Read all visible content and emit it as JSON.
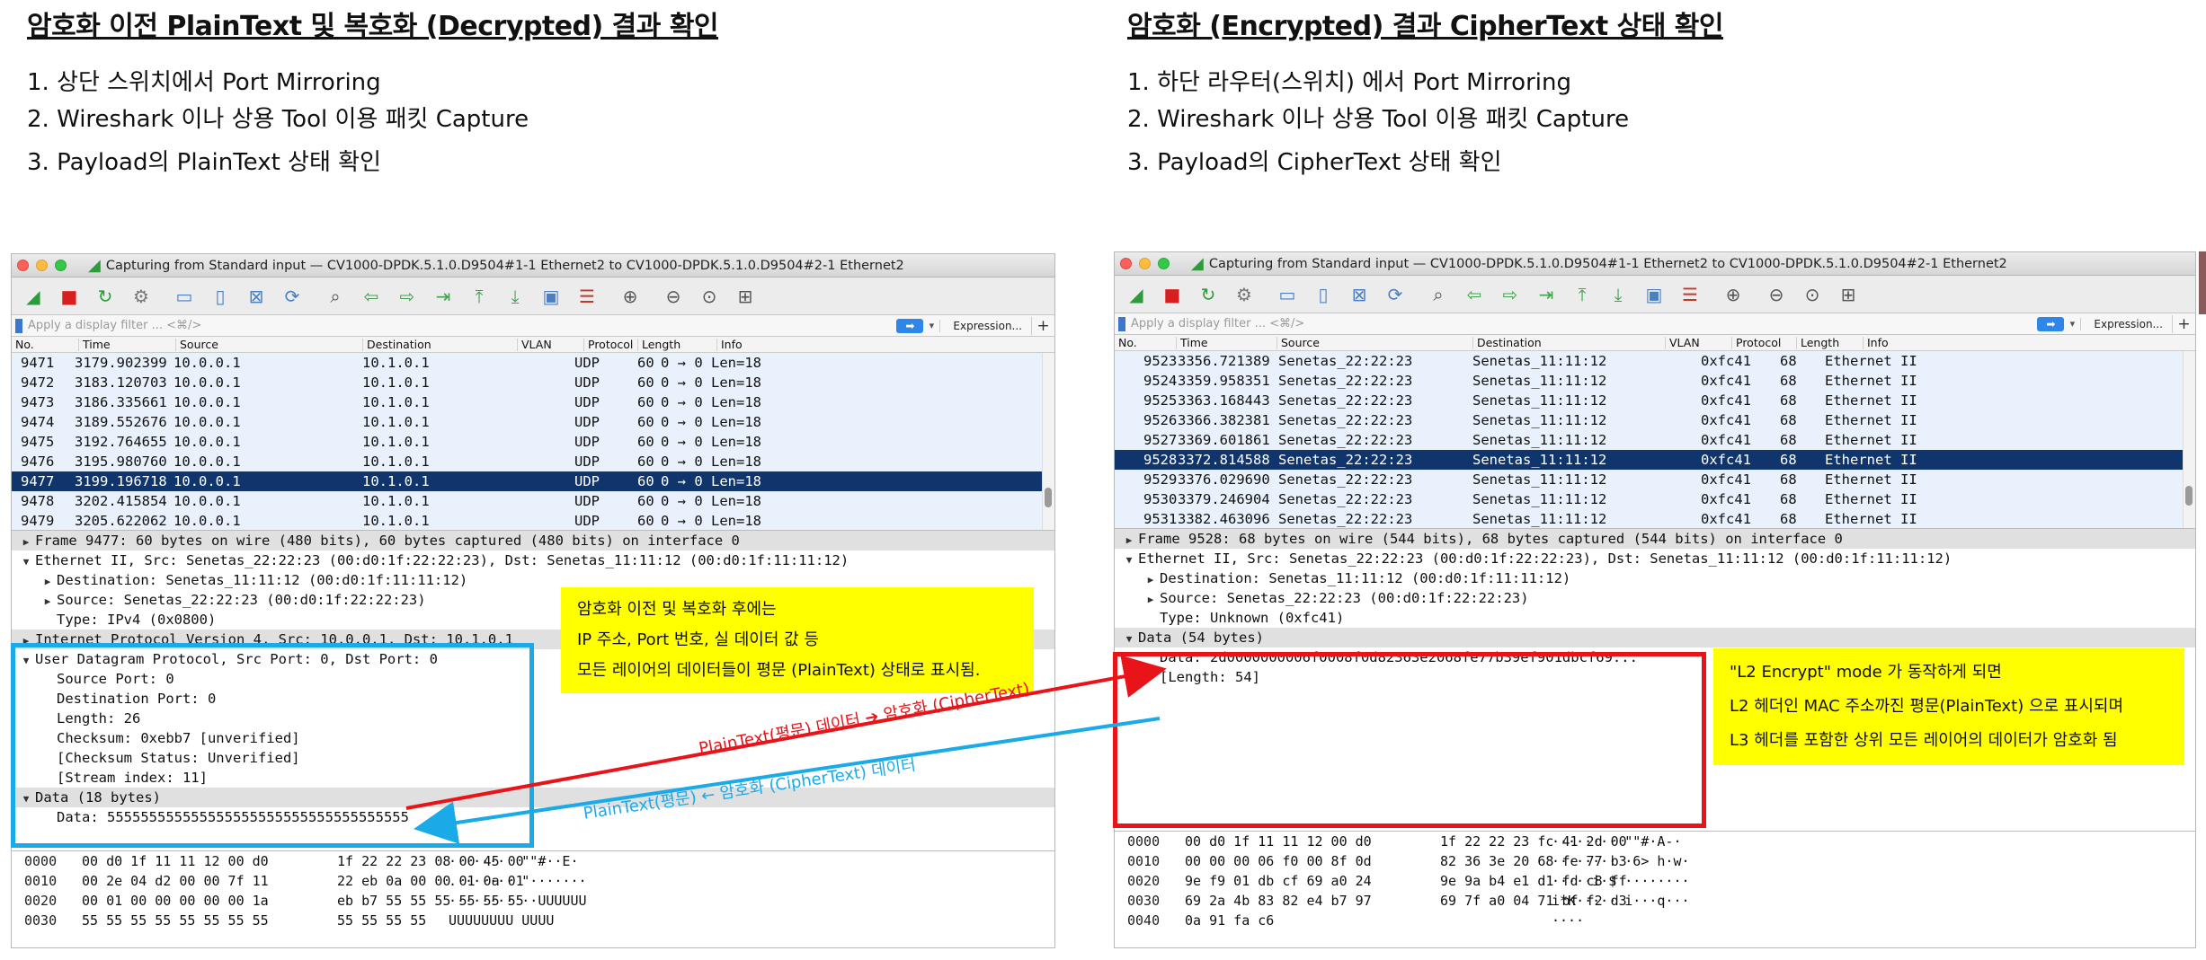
{
  "left": {
    "heading": "암호화 이전 PlainText 및 복호화 (Decrypted) 결과 확인",
    "steps": [
      "1. 상단 스위치에서 Port Mirroring",
      "2. Wireshark 이나 상용 Tool 이용 패킷 Capture",
      "3. Payload의 PlainText 상태 확인"
    ],
    "window_title": "Capturing from Standard input — CV1000-DPDK.5.1.0.D9504#1-1 Ethernet2 to CV1000-DPDK.5.1.0.D9504#2-1 Ethernet2",
    "filter_placeholder": "Apply a display filter ... <⌘/>",
    "expression_label": "Expression...",
    "columns": [
      "No.",
      "Time",
      "Source",
      "Destination",
      "VLAN",
      "Protocol",
      "Length",
      "Info"
    ],
    "packets": [
      {
        "no": "9471",
        "time": "3179.902399",
        "src": "10.0.0.1",
        "dst": "10.1.0.1",
        "vlan": "",
        "proto": "UDP",
        "len": "60",
        "info": "0 → 0 Len=18"
      },
      {
        "no": "9472",
        "time": "3183.120703",
        "src": "10.0.0.1",
        "dst": "10.1.0.1",
        "vlan": "",
        "proto": "UDP",
        "len": "60",
        "info": "0 → 0 Len=18"
      },
      {
        "no": "9473",
        "time": "3186.335661",
        "src": "10.0.0.1",
        "dst": "10.1.0.1",
        "vlan": "",
        "proto": "UDP",
        "len": "60",
        "info": "0 → 0 Len=18"
      },
      {
        "no": "9474",
        "time": "3189.552676",
        "src": "10.0.0.1",
        "dst": "10.1.0.1",
        "vlan": "",
        "proto": "UDP",
        "len": "60",
        "info": "0 → 0 Len=18"
      },
      {
        "no": "9475",
        "time": "3192.764655",
        "src": "10.0.0.1",
        "dst": "10.1.0.1",
        "vlan": "",
        "proto": "UDP",
        "len": "60",
        "info": "0 → 0 Len=18"
      },
      {
        "no": "9476",
        "time": "3195.980760",
        "src": "10.0.0.1",
        "dst": "10.1.0.1",
        "vlan": "",
        "proto": "UDP",
        "len": "60",
        "info": "0 → 0 Len=18"
      },
      {
        "no": "9477",
        "time": "3199.196718",
        "src": "10.0.0.1",
        "dst": "10.1.0.1",
        "vlan": "",
        "proto": "UDP",
        "len": "60",
        "info": "0 → 0 Len=18",
        "selected": true
      },
      {
        "no": "9478",
        "time": "3202.415854",
        "src": "10.0.0.1",
        "dst": "10.1.0.1",
        "vlan": "",
        "proto": "UDP",
        "len": "60",
        "info": "0 → 0 Len=18"
      },
      {
        "no": "9479",
        "time": "3205.622062",
        "src": "10.0.0.1",
        "dst": "10.1.0.1",
        "vlan": "",
        "proto": "UDP",
        "len": "60",
        "info": "0 → 0 Len=18"
      }
    ],
    "details": [
      {
        "indent": 0,
        "toggle": "▶",
        "text": "Frame 9477: 60 bytes on wire (480 bits), 60 bytes captured (480 bits) on interface 0",
        "hl": true
      },
      {
        "indent": 0,
        "toggle": "▼",
        "text": "Ethernet II, Src: Senetas_22:22:23 (00:d0:1f:22:22:23), Dst: Senetas_11:11:12 (00:d0:1f:11:11:12)",
        "hl": false
      },
      {
        "indent": 1,
        "toggle": "▶",
        "text": "Destination: Senetas_11:11:12 (00:d0:1f:11:11:12)",
        "hl": false
      },
      {
        "indent": 1,
        "toggle": "▶",
        "text": "Source: Senetas_22:22:23 (00:d0:1f:22:22:23)",
        "hl": false
      },
      {
        "indent": 1,
        "toggle": "",
        "text": "Type: IPv4 (0x0800)",
        "hl": false
      },
      {
        "indent": 0,
        "toggle": "▶",
        "text": "Internet Protocol Version 4, Src: 10.0.0.1, Dst: 10.1.0.1",
        "hl": true
      },
      {
        "indent": 0,
        "toggle": "▼",
        "text": "User Datagram Protocol, Src Port: 0, Dst Port: 0",
        "hl": false
      },
      {
        "indent": 1,
        "toggle": "",
        "text": "Source Port: 0",
        "hl": false
      },
      {
        "indent": 1,
        "toggle": "",
        "text": "Destination Port: 0",
        "hl": false
      },
      {
        "indent": 1,
        "toggle": "",
        "text": "Length: 26",
        "hl": false
      },
      {
        "indent": 1,
        "toggle": "",
        "text": "Checksum: 0xebb7 [unverified]",
        "hl": false
      },
      {
        "indent": 1,
        "toggle": "",
        "text": "[Checksum Status: Unverified]",
        "hl": false
      },
      {
        "indent": 1,
        "toggle": "",
        "text": "[Stream index: 11]",
        "hl": false
      },
      {
        "indent": 0,
        "toggle": "▼",
        "text": "Data (18 bytes)",
        "hl": true
      },
      {
        "indent": 1,
        "toggle": "",
        "text": "Data: 555555555555555555555555555555555555",
        "hl": false
      }
    ],
    "hex": [
      {
        "off": "0000",
        "a": "00 d0 1f 11 11 12 00 d0",
        "b": "1f 22 22 23 08 00 45 00",
        "ascii": "·······  \"\"#··E·"
      },
      {
        "off": "0010",
        "a": "00 2e 04 d2 00 00 7f 11",
        "b": "22 eb 0a 00 00 01 0a 01",
        "ascii": ".······· \"·······"
      },
      {
        "off": "0020",
        "a": "00 01 00 00 00 00 00 1a",
        "b": "eb b7 55 55 55 55 55 55",
        "ascii": "········ ··UUUUUU"
      },
      {
        "off": "0030",
        "a": "55 55 55 55 55 55 55 55",
        "b": "55 55 55 55",
        "ascii": "UUUUUUUU UUUU"
      }
    ],
    "callout": [
      "암호화 이전 및 복호화 후에는",
      "IP 주소, Port 번호, 실 데이터 값 등",
      "모든 레이어의 데이터들이 평문 (PlainText) 상태로 표시됨."
    ]
  },
  "right": {
    "heading": "암호화 (Encrypted) 결과 CipherText 상태 확인",
    "steps": [
      "1. 하단 라우터(스위치) 에서 Port Mirroring",
      "2. Wireshark 이나 상용 Tool 이용 패킷 Capture",
      "3. Payload의 CipherText 상태 확인"
    ],
    "window_title": "Capturing from Standard input — CV1000-DPDK.5.1.0.D9504#1-1 Ethernet2 to CV1000-DPDK.5.1.0.D9504#2-1 Ethernet2",
    "filter_placeholder": "Apply a display filter ... <⌘/>",
    "expression_label": "Expression...",
    "columns": [
      "No.",
      "Time",
      "Source",
      "Destination",
      "VLAN",
      "Protocol",
      "Length",
      "Info"
    ],
    "packets": [
      {
        "no": "9523",
        "time": "3356.721389",
        "src": "Senetas_22:22:23",
        "dst": "Senetas_11:11:12",
        "vlan": "",
        "proto": "0xfc41",
        "len": "68",
        "info": "Ethernet II"
      },
      {
        "no": "9524",
        "time": "3359.958351",
        "src": "Senetas_22:22:23",
        "dst": "Senetas_11:11:12",
        "vlan": "",
        "proto": "0xfc41",
        "len": "68",
        "info": "Ethernet II"
      },
      {
        "no": "9525",
        "time": "3363.168443",
        "src": "Senetas_22:22:23",
        "dst": "Senetas_11:11:12",
        "vlan": "",
        "proto": "0xfc41",
        "len": "68",
        "info": "Ethernet II"
      },
      {
        "no": "9526",
        "time": "3366.382381",
        "src": "Senetas_22:22:23",
        "dst": "Senetas_11:11:12",
        "vlan": "",
        "proto": "0xfc41",
        "len": "68",
        "info": "Ethernet II"
      },
      {
        "no": "9527",
        "time": "3369.601861",
        "src": "Senetas_22:22:23",
        "dst": "Senetas_11:11:12",
        "vlan": "",
        "proto": "0xfc41",
        "len": "68",
        "info": "Ethernet II"
      },
      {
        "no": "9528",
        "time": "3372.814588",
        "src": "Senetas_22:22:23",
        "dst": "Senetas_11:11:12",
        "vlan": "",
        "proto": "0xfc41",
        "len": "68",
        "info": "Ethernet II",
        "selected": true
      },
      {
        "no": "9529",
        "time": "3376.029690",
        "src": "Senetas_22:22:23",
        "dst": "Senetas_11:11:12",
        "vlan": "",
        "proto": "0xfc41",
        "len": "68",
        "info": "Ethernet II"
      },
      {
        "no": "9530",
        "time": "3379.246904",
        "src": "Senetas_22:22:23",
        "dst": "Senetas_11:11:12",
        "vlan": "",
        "proto": "0xfc41",
        "len": "68",
        "info": "Ethernet II"
      },
      {
        "no": "9531",
        "time": "3382.463096",
        "src": "Senetas_22:22:23",
        "dst": "Senetas_11:11:12",
        "vlan": "",
        "proto": "0xfc41",
        "len": "68",
        "info": "Ethernet II"
      }
    ],
    "details": [
      {
        "indent": 0,
        "toggle": "▶",
        "text": "Frame 9528: 68 bytes on wire (544 bits), 68 bytes captured (544 bits) on interface 0",
        "hl": true
      },
      {
        "indent": 0,
        "toggle": "▼",
        "text": "Ethernet II, Src: Senetas_22:22:23 (00:d0:1f:22:22:23), Dst: Senetas_11:11:12 (00:d0:1f:11:11:12)",
        "hl": false
      },
      {
        "indent": 1,
        "toggle": "▶",
        "text": "Destination: Senetas_11:11:12 (00:d0:1f:11:11:12)",
        "hl": false
      },
      {
        "indent": 1,
        "toggle": "▶",
        "text": "Source: Senetas_22:22:23 (00:d0:1f:22:22:23)",
        "hl": false
      },
      {
        "indent": 1,
        "toggle": "",
        "text": "Type: Unknown (0xfc41)",
        "hl": false
      },
      {
        "indent": 0,
        "toggle": "▼",
        "text": "Data (54 bytes)",
        "hl": true
      },
      {
        "indent": 1,
        "toggle": "",
        "text": "Data: 2d0000000006f0008f0d82363e2068fe77b39ef901dbcf69...",
        "hl": false
      },
      {
        "indent": 1,
        "toggle": "",
        "text": "[Length: 54]",
        "hl": false
      }
    ],
    "hex": [
      {
        "off": "0000",
        "a": "00 d0 1f 11 11 12 00 d0",
        "b": "1f 22 22 23 fc 41 2d 00",
        "ascii": "········ \"\"#·A-·"
      },
      {
        "off": "0010",
        "a": "00 00 00 06 f0 00 8f 0d",
        "b": "82 36 3e 20 68 fe 77 b3",
        "ascii": "········ ·6> h·w·"
      },
      {
        "off": "0020",
        "a": "9e f9 01 db cf 69 a0 24",
        "b": "9e 9a b4 e1 d1 fd c8 ff",
        "ascii": "·····i·$ ········"
      },
      {
        "off": "0030",
        "a": "69 2a 4b 83 82 e4 b7 97",
        "b": "69 7f a0 04 71 bf f2 d3",
        "ascii": "i*K····· i···q···"
      },
      {
        "off": "0040",
        "a": "0a 91 fa c6",
        "b": "",
        "ascii": "····"
      }
    ],
    "callout": [
      "\"L2 Encrypt\" mode 가 동작하게 되면",
      "L2 헤더인 MAC 주소까진 평문(PlainText) 으로 표시되며",
      "L3 헤더를 포함한 상위 모든 레이어의 데이터가 암호화 됨"
    ]
  },
  "arrow_labels": {
    "red": "PlainText(평문) 데이터 ➔ 암호화 (CipherText)",
    "blue": "PlainText(평문) ← 암호화 (CipherText) 데이터"
  },
  "colors": {
    "red": "#e8141a",
    "blue": "#1aaae8",
    "yellow": "#ffff00",
    "selected_row": "#10356c",
    "row_bg": "#e8f1fc"
  },
  "toolbar_icons": [
    "shark-fin-icon",
    "stop-icon",
    "restart-icon",
    "options-gear-icon",
    "open-folder-icon",
    "save-file-icon",
    "close-file-icon",
    "reload-icon",
    "find-icon",
    "back-arrow-icon",
    "forward-arrow-icon",
    "go-to-packet-icon",
    "first-packet-icon",
    "last-packet-icon",
    "autoscroll-icon",
    "colorize-icon",
    "zoom-in-icon",
    "zoom-out-icon",
    "normal-size-icon",
    "resize-columns-icon"
  ]
}
